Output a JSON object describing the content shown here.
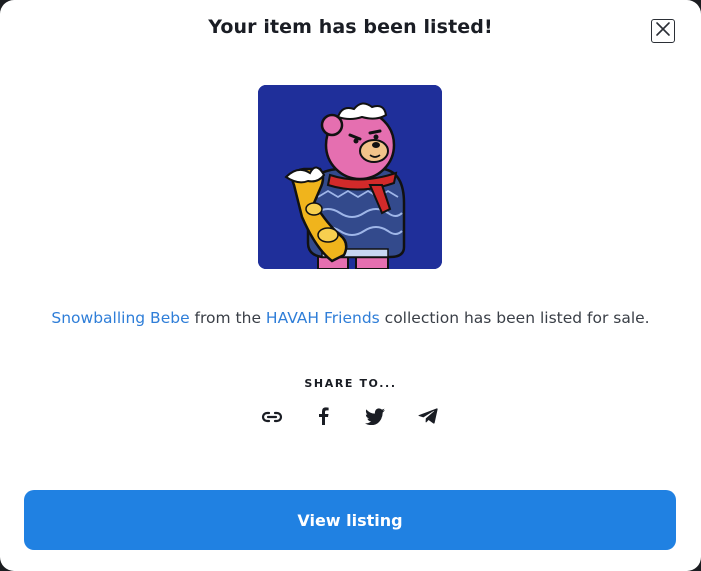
{
  "modal": {
    "title": "Your item has been listed!",
    "close_icon": "close-icon"
  },
  "item": {
    "name": "Snowballing Bebe",
    "collection": "HAVAH Friends",
    "text_from": "from the",
    "text_suffix": "collection has been listed for sale.",
    "image_icon": "pink-bear-nft-image"
  },
  "share": {
    "label": "SHARE TO...",
    "icons": [
      "link-icon",
      "facebook-icon",
      "twitter-icon",
      "telegram-icon"
    ]
  },
  "actions": {
    "view_listing_label": "View listing"
  },
  "colors": {
    "accent": "#2081e2",
    "link": "#2f7ed8",
    "nft_background": "#1f2f9a"
  }
}
